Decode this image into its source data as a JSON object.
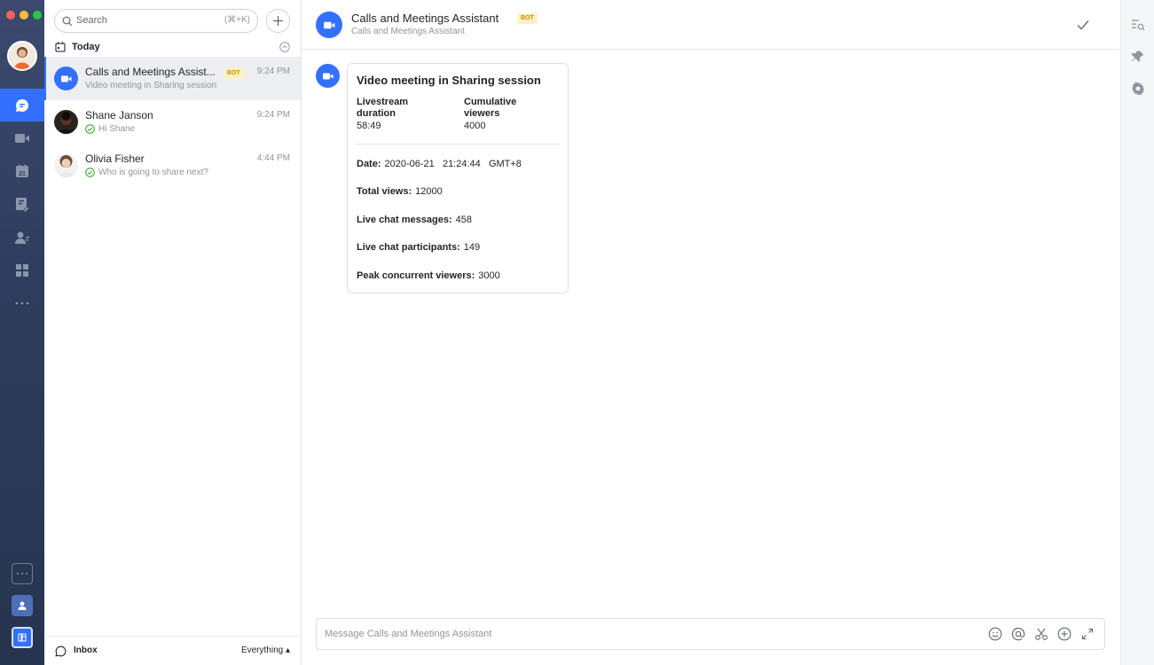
{
  "colors": {
    "accent": "#3370ff",
    "rail_bg": "#2f3d5e",
    "badge_text": "#d08b00",
    "badge_bg": "#fdf0c4",
    "success": "#2ea121"
  },
  "rail": {
    "items": [
      {
        "icon": "chat-bubble-icon",
        "active": true
      },
      {
        "icon": "video-camera-icon",
        "active": false
      },
      {
        "icon": "calendar-icon",
        "active": false
      },
      {
        "icon": "docs-icon",
        "active": false
      },
      {
        "icon": "contacts-icon",
        "active": false
      },
      {
        "icon": "workplace-grid-icon",
        "active": false
      },
      {
        "icon": "more-icon",
        "active": false
      }
    ],
    "bottom": [
      {
        "icon": "more-apps-icon"
      },
      {
        "icon": "profile-icon"
      },
      {
        "icon": "tenant-logo-icon"
      }
    ]
  },
  "list": {
    "search_placeholder": "Search",
    "search_shortcut": "(⌘+K)",
    "section_label": "Today",
    "conversations": [
      {
        "name": "Calls and Meetings Assist...",
        "badge": "BOT",
        "time": "9:24 PM",
        "preview": "Video meeting in Sharing session",
        "selected": true,
        "read_receipt": false
      },
      {
        "name": "Shane Janson",
        "badge": "",
        "time": "9:24 PM",
        "preview": "Hi Shane",
        "selected": false,
        "read_receipt": true
      },
      {
        "name": "Olivia Fisher",
        "badge": "",
        "time": "4:44 PM",
        "preview": "Who is going to share next?",
        "selected": false,
        "read_receipt": true
      }
    ],
    "footer": {
      "inbox_label": "Inbox",
      "filter_label": "Everything ▴"
    }
  },
  "chat": {
    "title": "Calls and Meetings Assistant",
    "badge": "BOT",
    "subtitle": "Calls and Meetings Assistant",
    "card": {
      "title": "Video meeting in Sharing session",
      "columns": [
        {
          "label_line1": "Livestream",
          "label_line2": "duration",
          "value": "58:49"
        },
        {
          "label_line1": "Cumulative",
          "label_line2": "viewers",
          "value": "4000"
        }
      ],
      "rows": [
        {
          "label": "Date:",
          "value": "2020-06-21   21:24:44   GMT+8"
        },
        {
          "label": "Total views:",
          "value": "12000"
        },
        {
          "label": "Live chat messages:",
          "value": "458"
        },
        {
          "label": "Live chat participants:",
          "value": "149"
        },
        {
          "label": "Peak concurrent viewers:",
          "value": "3000"
        }
      ]
    },
    "composer_placeholder": "Message Calls and Meetings Assistant"
  }
}
